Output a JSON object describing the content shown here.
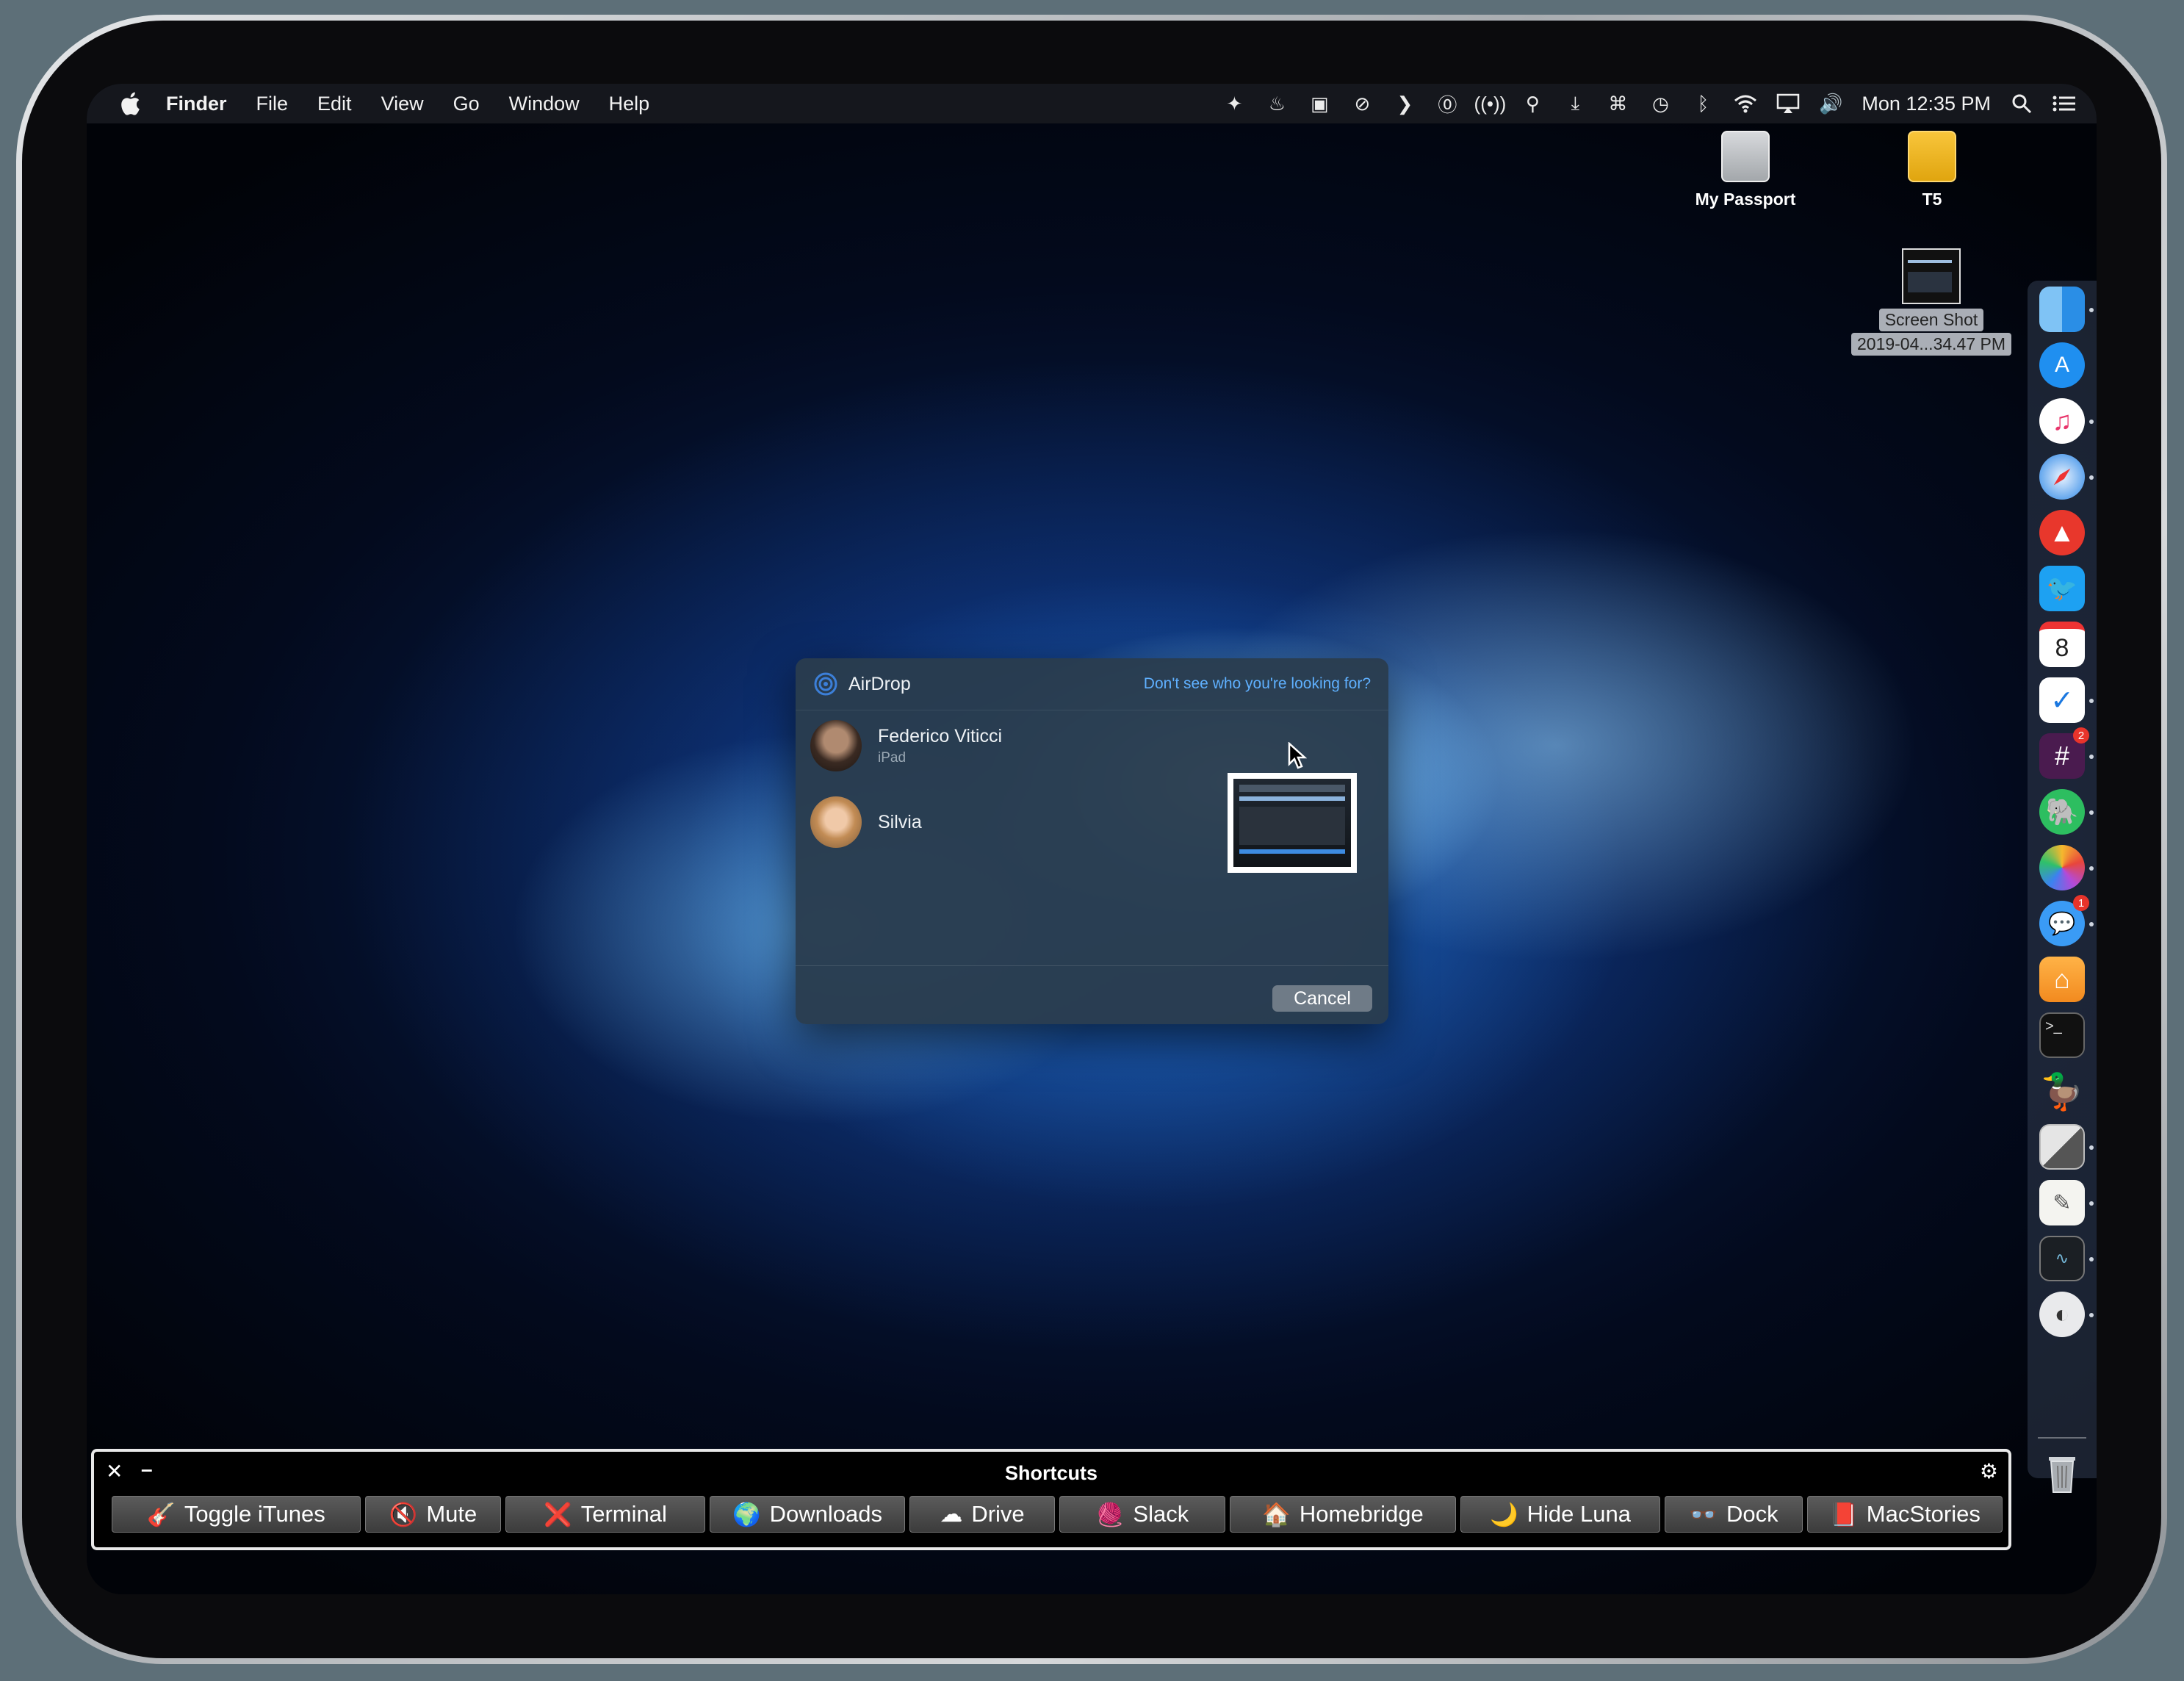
{
  "menubar": {
    "apple_icon": "apple-logo-icon",
    "app_name": "Finder",
    "menus": [
      "File",
      "Edit",
      "View",
      "Go",
      "Window",
      "Help"
    ],
    "status_icons": [
      "dropbox-icon",
      "flame-icon",
      "screen-icon",
      "no-location-icon",
      "chevron-right-icon",
      "1password-icon",
      "broadcast-icon",
      "broom-icon",
      "download-tray-icon",
      "command-icon",
      "time-machine-icon",
      "bluetooth-icon",
      "wifi-icon",
      "airplay-icon",
      "volume-icon"
    ],
    "clock": "Mon 12:35 PM",
    "right_icons": [
      "spotlight-search-icon",
      "notification-center-icon"
    ]
  },
  "desktop": {
    "items": [
      {
        "label": "My Passport",
        "icon": "external-drive-icon"
      },
      {
        "label": "T5",
        "icon": "external-drive-icon"
      },
      {
        "label_line1": "Screen Shot",
        "label_line2": "2019-04...34.47 PM",
        "icon": "screenshot-file-icon"
      }
    ]
  },
  "airdrop": {
    "title": "AirDrop",
    "help_link": "Don't see who you're looking for?",
    "people": [
      {
        "name": "Federico Viticci",
        "device": "iPad"
      },
      {
        "name": "Silvia",
        "device": ""
      }
    ],
    "cancel_label": "Cancel"
  },
  "dock": {
    "apps": [
      {
        "name": "finder-icon",
        "running": true
      },
      {
        "name": "app-store-icon",
        "running": false
      },
      {
        "name": "itunes-icon",
        "running": true
      },
      {
        "name": "safari-icon",
        "running": true
      },
      {
        "name": "spark-icon",
        "running": false
      },
      {
        "name": "twitter-icon",
        "running": false
      },
      {
        "name": "calendar-icon",
        "running": false,
        "label": "8"
      },
      {
        "name": "things-icon",
        "running": true
      },
      {
        "name": "slack-icon",
        "running": true,
        "badge": "2"
      },
      {
        "name": "evernote-icon",
        "running": true
      },
      {
        "name": "photos-icon",
        "running": true
      },
      {
        "name": "messages-icon",
        "running": true,
        "badge": "1"
      },
      {
        "name": "home-icon",
        "running": false
      },
      {
        "name": "terminal-icon",
        "running": false
      },
      {
        "name": "cyberduck-icon",
        "running": false
      },
      {
        "name": "screenshot-editor-icon",
        "running": true
      },
      {
        "name": "textedit-icon",
        "running": true
      },
      {
        "name": "console-icon",
        "running": true
      },
      {
        "name": "luna-display-icon",
        "running": true
      }
    ],
    "trash": "trash-icon"
  },
  "shortcuts_panel": {
    "title": "Shortcuts",
    "buttons": [
      {
        "label": "Toggle iTunes",
        "emoji": "🎸"
      },
      {
        "label": "Mute",
        "emoji": "🔇"
      },
      {
        "label": "Terminal",
        "emoji": "❌"
      },
      {
        "label": "Downloads",
        "emoji": "🌍"
      },
      {
        "label": "Drive",
        "emoji": "☁"
      },
      {
        "label": "Slack",
        "emoji": "🧶"
      },
      {
        "label": "Homebridge",
        "emoji": "🏠"
      },
      {
        "label": "Hide Luna",
        "emoji": "🌙"
      },
      {
        "label": "Dock",
        "emoji": "👓"
      },
      {
        "label": "MacStories",
        "emoji": "📕"
      }
    ]
  },
  "colors": {
    "accent_link": "#5fb0ff",
    "badge": "#e8342b"
  }
}
